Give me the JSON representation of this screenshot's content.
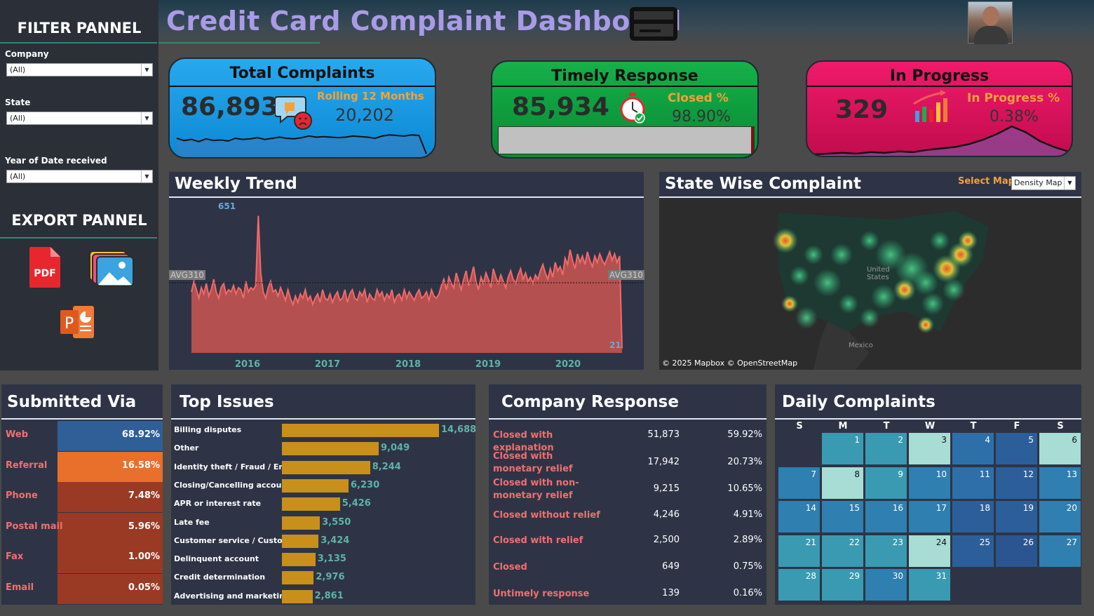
{
  "header": {
    "title": "Credit Card Complaint Dashboard"
  },
  "sidebar": {
    "filter_title": "FILTER PANNEL",
    "filters": [
      {
        "label": "Company",
        "value": "(All)"
      },
      {
        "label": "State",
        "value": "(All)"
      },
      {
        "label": "Year of Date received",
        "value": "(All)"
      }
    ],
    "export_title": "EXPORT PANNEL",
    "export_pdf_label": "PDF"
  },
  "kpis": {
    "total": {
      "title": "Total Complaints",
      "value": "86,893",
      "sub_label": "Rolling 12 Months",
      "sub_value": "20,202",
      "color": "#1aa3e8"
    },
    "timely": {
      "title": "Timely Response",
      "value": "85,934",
      "sub_label": "Closed %",
      "sub_value": "98.90%",
      "progress": 0.989,
      "color": "#0a9a3a"
    },
    "progress": {
      "title": "In Progress",
      "value": "329",
      "sub_label": "In Progress %",
      "sub_value": "0.38%",
      "color": "#e8105e"
    }
  },
  "weekly_trend": {
    "title": "Weekly Trend",
    "avg_label_left": "AVG310",
    "avg_label_right": "AVG310",
    "peak_label": "651",
    "end_label": "21"
  },
  "state_map": {
    "title": "State Wise Complaint",
    "select_label": "Select Map",
    "select_value": "Density Map",
    "attribution": "© 2025 Mapbox © OpenStreetMap",
    "label_us": "United States",
    "label_mexico": "Mexico"
  },
  "submitted_via": {
    "title": "Submitted Via",
    "rows": [
      {
        "label": "Web",
        "value": "68.92%",
        "color": "#2f5f96"
      },
      {
        "label": "Referral",
        "value": "16.58%",
        "color": "#e8702a"
      },
      {
        "label": "Phone",
        "value": "7.48%",
        "color": "#9a3a24"
      },
      {
        "label": "Postal mail",
        "value": "5.96%",
        "color": "#9a3a24"
      },
      {
        "label": "Fax",
        "value": "1.00%",
        "color": "#9a3a24"
      },
      {
        "label": "Email",
        "value": "0.05%",
        "color": "#9a3a24"
      }
    ]
  },
  "top_issues": {
    "title": "Top Issues",
    "rows": [
      {
        "label": "Billing disputes",
        "value": "14,688"
      },
      {
        "label": "Other",
        "value": "9,049"
      },
      {
        "label": "Identity theft / Fraud / Em..",
        "value": "8,244"
      },
      {
        "label": "Closing/Cancelling account",
        "value": "6,230"
      },
      {
        "label": "APR or interest rate",
        "value": "5,426"
      },
      {
        "label": "Late fee",
        "value": "3,550"
      },
      {
        "label": "Customer service / Custom..",
        "value": "3,424"
      },
      {
        "label": "Delinquent account",
        "value": "3,135"
      },
      {
        "label": "Credit determination",
        "value": "2,976"
      },
      {
        "label": "Advertising and marketing",
        "value": "2,861"
      }
    ]
  },
  "company_response": {
    "title": "Company Response",
    "rows": [
      {
        "label": "Closed with explanation",
        "count": "51,873",
        "pct": "59.92%"
      },
      {
        "label": "Closed with monetary relief",
        "count": "17,942",
        "pct": "20.73%"
      },
      {
        "label": "Closed with non-monetary relief",
        "count": "9,215",
        "pct": "10.65%"
      },
      {
        "label": "Closed without relief",
        "count": "4,246",
        "pct": "4.91%"
      },
      {
        "label": "Closed with relief",
        "count": "2,500",
        "pct": "2.89%"
      },
      {
        "label": "Closed",
        "count": "649",
        "pct": "0.75%"
      },
      {
        "label": "Untimely response",
        "count": "139",
        "pct": "0.16%"
      }
    ]
  },
  "daily_complaints": {
    "title": "Daily Complaints",
    "weekdays": [
      "S",
      "M",
      "T",
      "W",
      "T",
      "F",
      "S"
    ]
  },
  "chart_data": [
    {
      "type": "area",
      "title": "Weekly Trend",
      "x_ticks": [
        "2016",
        "2017",
        "2018",
        "2019",
        "2020"
      ],
      "reference_line": 310,
      "max_label": 651,
      "last_label": 21,
      "series": [
        {
          "values": [
            290,
            340,
            300,
            260,
            310,
            280,
            330,
            270,
            300,
            350,
            290,
            260,
            310,
            330,
            280,
            300,
            290,
            320,
            280,
            310,
            300,
            260,
            340,
            290,
            310,
            300,
            320,
            651,
            380,
            290,
            260,
            310,
            340,
            290,
            300,
            270,
            310,
            280,
            250,
            300,
            260,
            230,
            270,
            240,
            280,
            260,
            300,
            250,
            270,
            230,
            260,
            280,
            240,
            300,
            260,
            250,
            280,
            240,
            270,
            290,
            250,
            260,
            300,
            240,
            280,
            300,
            260,
            250,
            290,
            270,
            300,
            240,
            280,
            260,
            250,
            300,
            270,
            290,
            250,
            280,
            260,
            300,
            240,
            270,
            280,
            250,
            300,
            260,
            290,
            270,
            250,
            280,
            300,
            260,
            270,
            290,
            250,
            300,
            270,
            260,
            280,
            320,
            350,
            300,
            360,
            330,
            310,
            380,
            340,
            300,
            350,
            390,
            320,
            360,
            410,
            340,
            300,
            360,
            330,
            380,
            350,
            310,
            400,
            360,
            330,
            370,
            340,
            310,
            360,
            390,
            350,
            330,
            370,
            400,
            350,
            380,
            340,
            360,
            330,
            370,
            350,
            390,
            420,
            380,
            350,
            400,
            360,
            430,
            390,
            410,
            370,
            450,
            420,
            490,
            440,
            400,
            470,
            430,
            460,
            420,
            480,
            440,
            410,
            460,
            430,
            470,
            440,
            420,
            450,
            480,
            440,
            470,
            430,
            460,
            21
          ]
        }
      ]
    },
    {
      "type": "line",
      "title": "Total Complaints",
      "series": [
        {
          "values": [
            1700,
            1500,
            1600,
            1400,
            1650,
            1500,
            1550,
            1450,
            1700,
            1600,
            1650,
            1750,
            1600,
            1700,
            1800,
            1700,
            1650,
            1750,
            1900,
            1800,
            1850,
            1800,
            1750,
            1800,
            1900,
            1850,
            1800,
            1700,
            1900,
            2000,
            1950,
            1900,
            2000,
            1950,
            300
          ]
        }
      ]
    },
    {
      "type": "area",
      "title": "In Progress",
      "series": [
        {
          "values": [
            0,
            1,
            2,
            1,
            3,
            2,
            4,
            3,
            6,
            8,
            10,
            14,
            20,
            28,
            38,
            30,
            18,
            10,
            4
          ]
        }
      ]
    },
    {
      "type": "bar",
      "title": "Top Issues",
      "categories": [
        "Billing disputes",
        "Other",
        "Identity theft / Fraud / Em..",
        "Closing/Cancelling account",
        "APR or interest rate",
        "Late fee",
        "Customer service / Custom..",
        "Delinquent account",
        "Credit determination",
        "Advertising and marketing"
      ],
      "values": [
        14688,
        9049,
        8244,
        6230,
        5426,
        3550,
        3424,
        3135,
        2976,
        2861
      ]
    },
    {
      "type": "bar",
      "title": "Submitted Via",
      "categories": [
        "Web",
        "Referral",
        "Phone",
        "Postal mail",
        "Fax",
        "Email"
      ],
      "values": [
        68.92,
        16.58,
        7.48,
        5.96,
        1.0,
        0.05
      ]
    },
    {
      "type": "heatmap",
      "title": "Daily Complaints",
      "categories": [
        "S",
        "M",
        "T",
        "W",
        "T",
        "F",
        "S"
      ],
      "values": [
        null,
        3,
        3,
        2,
        5,
        6,
        2,
        4,
        2,
        3,
        4,
        5,
        6,
        4,
        4,
        4,
        4,
        4,
        6,
        6,
        4,
        3,
        3,
        3,
        2,
        6,
        7,
        4,
        3,
        3,
        4,
        3
      ]
    }
  ]
}
